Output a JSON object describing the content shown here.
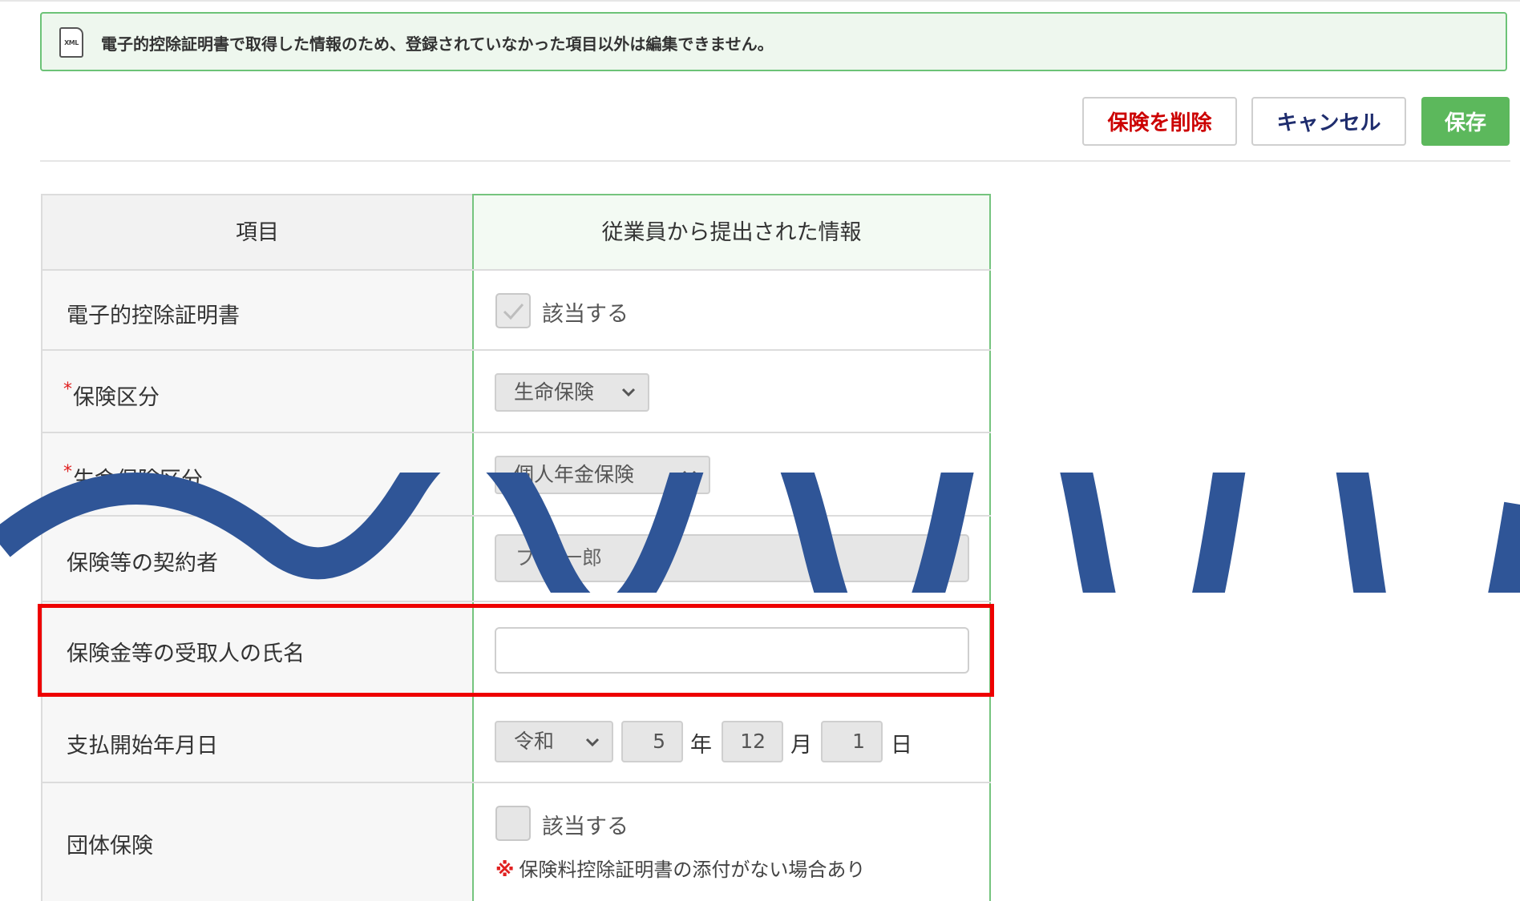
{
  "notice": {
    "icon": "xml-file-icon",
    "icon_text": "XML",
    "message": "電子的控除証明書で取得した情報のため、登録されていなかった項目以外は編集できません。"
  },
  "toolbar": {
    "delete_label": "保険を削除",
    "cancel_label": "キャンセル",
    "save_label": "保存"
  },
  "table": {
    "header_item": "項目",
    "header_info": "従業員から提出された情報",
    "required_mark": "*",
    "rows": {
      "electronic_cert": {
        "label": "電子的控除証明書",
        "checkbox_label": "該当する",
        "checked": true
      },
      "insurance_type": {
        "label": "保険区分",
        "required": true,
        "value": "生命保険"
      },
      "life_insurance_type": {
        "label": "生命保険区分",
        "required": true,
        "value": "個人年金保険"
      },
      "contractor": {
        "label": "保険等の契約者",
        "value": "プル 一郎"
      },
      "recipient": {
        "label": "保険金等の受取人の氏名",
        "value": ""
      },
      "payment_start": {
        "label": "支払開始年月日",
        "era": "令和",
        "year": "5",
        "year_unit": "年",
        "month": "12",
        "month_unit": "月",
        "day": "1",
        "day_unit": "日"
      },
      "group_insurance": {
        "label": "団体保険",
        "checkbox_label": "該当する",
        "checked": false,
        "note_mark": "※",
        "note": "保険料控除証明書の添付がない場合あり"
      }
    }
  },
  "colors": {
    "accent_green": "#5cb85c",
    "delete_red": "#cc0000",
    "cancel_navy": "#1f2d6e",
    "highlight_red": "#ee0000",
    "wave_blue": "#2f5597"
  }
}
